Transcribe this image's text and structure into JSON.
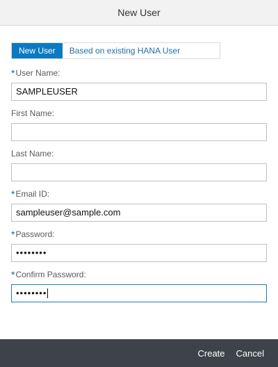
{
  "dialog": {
    "title": "New User"
  },
  "mode_selector": {
    "options": [
      "New User",
      "Based on existing HANA User"
    ],
    "selected": "New User"
  },
  "form": {
    "fields": [
      {
        "label": "User Name:",
        "required": true,
        "value": "SAMPLEUSER",
        "type": "text"
      },
      {
        "label": "First Name:",
        "required": false,
        "value": "",
        "type": "text"
      },
      {
        "label": "Last Name:",
        "required": false,
        "value": "",
        "type": "text"
      },
      {
        "label": "Email ID:",
        "required": true,
        "value": "sampleuser@sample.com",
        "type": "text"
      },
      {
        "label": "Password:",
        "required": true,
        "value": "••••••••",
        "type": "password"
      },
      {
        "label": "Confirm Password:",
        "required": true,
        "value": "••••••••",
        "type": "password",
        "focused": true
      }
    ]
  },
  "required_marker": "*",
  "footer": {
    "create_label": "Create",
    "cancel_label": "Cancel"
  },
  "colors": {
    "accent": "#0a7ac2",
    "footer_bg": "#3d4348",
    "header_bg": "#f2f2f2"
  }
}
